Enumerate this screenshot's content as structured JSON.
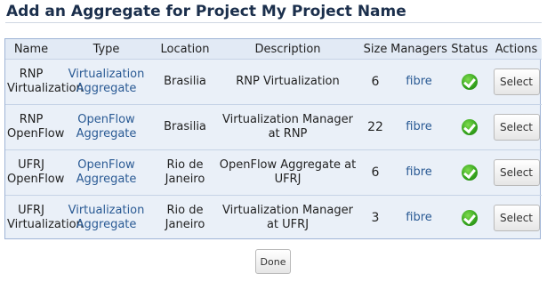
{
  "page": {
    "title": "Add an Aggregate for Project My Project Name"
  },
  "table": {
    "headers": [
      "Name",
      "Type",
      "Location",
      "Description",
      "Size",
      "Managers",
      "Status",
      "Actions"
    ],
    "rows": [
      {
        "name": "RNP Virtualization",
        "type": "Virtualization Aggregate",
        "location": "Brasilia",
        "description": "RNP Virtualization",
        "size": "6",
        "managers": "fibre",
        "status_icon": "check-icon",
        "action": "Select"
      },
      {
        "name": "RNP OpenFlow",
        "type": "OpenFlow Aggregate",
        "location": "Brasilia",
        "description": "Virtualization Manager at RNP",
        "size": "22",
        "managers": "fibre",
        "status_icon": "check-icon",
        "action": "Select"
      },
      {
        "name": "UFRJ OpenFlow",
        "type": "OpenFlow Aggregate",
        "location": "Rio de Janeiro",
        "description": "OpenFlow Aggregate at UFRJ",
        "size": "6",
        "managers": "fibre",
        "status_icon": "check-icon",
        "action": "Select"
      },
      {
        "name": "UFRJ Virtualization",
        "type": "Virtualization Aggregate",
        "location": "Rio de Janeiro",
        "description": "Virtualization Manager at UFRJ",
        "size": "3",
        "managers": "fibre",
        "status_icon": "check-icon",
        "action": "Select"
      }
    ]
  },
  "footer": {
    "done_label": "Done"
  },
  "colors": {
    "title": "#1b2f4c",
    "link": "#2a5a94",
    "table_bg": "#eaf0f8",
    "table_border": "#9fb4d6",
    "status_ok": "#33a21c"
  }
}
